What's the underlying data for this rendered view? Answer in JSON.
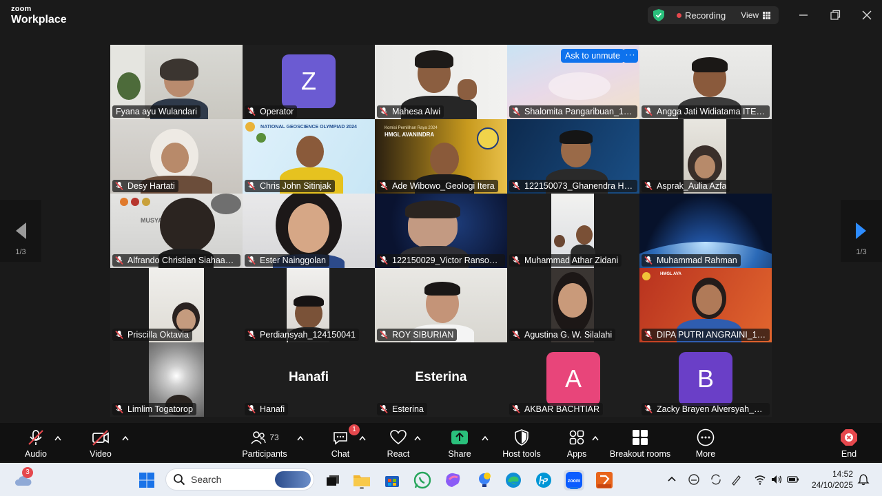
{
  "app": {
    "brand_top": "zoom",
    "brand_bottom": "Workplace"
  },
  "titlebar": {
    "recording_label": "Recording",
    "view_label": "View"
  },
  "pagination": {
    "left_page": "1/3",
    "right_page": "1/3"
  },
  "tiles": [
    {
      "name": "Fyana ayu Wulandari",
      "kind": "video",
      "active": true
    },
    {
      "name": "Operator",
      "kind": "avatar",
      "letter": "Z",
      "color": "#6b5bd2"
    },
    {
      "name": "Mahesa Alwi",
      "kind": "video"
    },
    {
      "name": "Shalomita Pangaribuan_122...",
      "kind": "video",
      "unmute_label": "Ask to unmute",
      "more_label": "···"
    },
    {
      "name": "Angga Jati Widiatama ITERA",
      "kind": "video"
    },
    {
      "name": "Desy Hartati",
      "kind": "video"
    },
    {
      "name": "Chris John Sitinjak",
      "kind": "video",
      "banner": "NATIONAL GEOSCIENCE OLYMPIAD 2024"
    },
    {
      "name": "Ade Wibowo_Geologi Itera",
      "kind": "video",
      "banner": "HMGL AVANINDRA",
      "banner_top": "Komisi Pemilihan Raya 2024"
    },
    {
      "name": "122150073_Ghanendra Hafi...",
      "kind": "video"
    },
    {
      "name": "Asprak_Aulia Azfa",
      "kind": "video"
    },
    {
      "name": "Alfrando Christian Siahaan_I...",
      "kind": "video",
      "banner": "MUSYA"
    },
    {
      "name": "Ester Nainggolan",
      "kind": "video"
    },
    {
      "name": "122150029_Victor Ranson Si...",
      "kind": "video"
    },
    {
      "name": "Muhammad Athar Zidani",
      "kind": "video"
    },
    {
      "name": "Muhammad Rahman",
      "kind": "video"
    },
    {
      "name": "Priscilla Oktavia",
      "kind": "video"
    },
    {
      "name": "Perdiansyah_124150041",
      "kind": "video"
    },
    {
      "name": "ROY SIBURIAN",
      "kind": "video"
    },
    {
      "name": "Agustina G. W. Silalahi",
      "kind": "video"
    },
    {
      "name": "DIPA PUTRI ANGRAINI_1231...",
      "kind": "video",
      "banner": "HMGL AVA"
    },
    {
      "name": "Limlim Togatorop",
      "kind": "video"
    },
    {
      "name": "Hanafi",
      "kind": "text",
      "big": "Hanafi"
    },
    {
      "name": "Esterina",
      "kind": "text",
      "big": "Esterina"
    },
    {
      "name": "AKBAR BACHTIAR",
      "kind": "avatar",
      "letter": "A",
      "color": "#e8457a"
    },
    {
      "name": "Zacky Brayen Alversyah_124...",
      "kind": "avatar",
      "letter": "B",
      "color": "#6a3fc7"
    }
  ],
  "toolbar": {
    "audio": "Audio",
    "video": "Video",
    "participants": "Participants",
    "participants_count": "73",
    "chat": "Chat",
    "chat_badge": "1",
    "react": "React",
    "share": "Share",
    "host_tools": "Host tools",
    "apps": "Apps",
    "breakout": "Breakout rooms",
    "more": "More",
    "end": "End"
  },
  "taskbar": {
    "weather_badge": "3",
    "search_placeholder": "Search",
    "time": "14:52",
    "date": "24/10/2025"
  },
  "colors": {
    "active_outline": "#2ac07c",
    "accent_blue": "#0e72ed",
    "share_green": "#2ac07c",
    "end_red": "#e5484d"
  }
}
